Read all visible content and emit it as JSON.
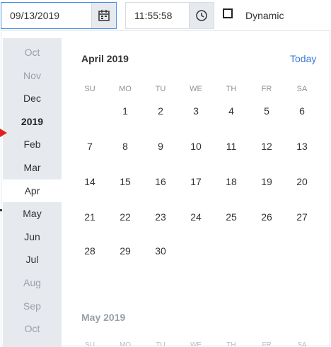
{
  "date_field": {
    "value": "09/13/2019",
    "icon": "calendar-icon"
  },
  "time_field": {
    "value": "11:55:58",
    "icon": "clock-icon"
  },
  "dynamic": {
    "label": "Dynamic",
    "checked": false
  },
  "months_list": [
    {
      "label": "Oct",
      "state": "faded"
    },
    {
      "label": "Nov",
      "state": "faded"
    },
    {
      "label": "Dec",
      "state": "normal"
    },
    {
      "label": "2019",
      "state": "year"
    },
    {
      "label": "Feb",
      "state": "normal"
    },
    {
      "label": "Mar",
      "state": "normal"
    },
    {
      "label": "Apr",
      "state": "selected"
    },
    {
      "label": "May",
      "state": "normal"
    },
    {
      "label": "Jun",
      "state": "normal"
    },
    {
      "label": "Jul",
      "state": "normal"
    },
    {
      "label": "Aug",
      "state": "faded"
    },
    {
      "label": "Sep",
      "state": "faded"
    },
    {
      "label": "Oct",
      "state": "faded"
    }
  ],
  "calendar": {
    "title": "April 2019",
    "today_label": "Today",
    "weekdays": [
      "SU",
      "MO",
      "TU",
      "WE",
      "TH",
      "FR",
      "SA"
    ],
    "weeks": [
      [
        "",
        "1",
        "2",
        "3",
        "4",
        "5",
        "6"
      ],
      [
        "7",
        "8",
        "9",
        "10",
        "11",
        "12",
        "13"
      ],
      [
        "14",
        "15",
        "16",
        "17",
        "18",
        "19",
        "20"
      ],
      [
        "21",
        "22",
        "23",
        "24",
        "25",
        "26",
        "27"
      ],
      [
        "28",
        "29",
        "30",
        "",
        "",
        "",
        ""
      ]
    ],
    "next_title": "May 2019"
  },
  "colors": {
    "accent": "#4a90e2",
    "link": "#3a7bd5",
    "panel": "#e6e9ee"
  }
}
